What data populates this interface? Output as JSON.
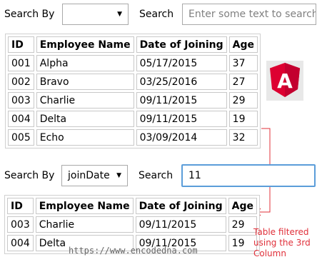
{
  "top": {
    "search_by_label": "Search By",
    "select_value": "",
    "search_label": "Search",
    "search_placeholder": "Enter some text to search",
    "table": {
      "headers": [
        "ID",
        "Employee Name",
        "Date of Joining",
        "Age"
      ],
      "rows": [
        [
          "001",
          "Alpha",
          "05/17/2015",
          "37"
        ],
        [
          "002",
          "Bravo",
          "03/25/2016",
          "27"
        ],
        [
          "003",
          "Charlie",
          "09/11/2015",
          "29"
        ],
        [
          "004",
          "Delta",
          "09/11/2015",
          "19"
        ],
        [
          "005",
          "Echo",
          "03/09/2014",
          "32"
        ]
      ]
    }
  },
  "bottom": {
    "search_by_label": "Search By",
    "select_value": "joinDate",
    "search_label": "Search",
    "search_value": "11",
    "table": {
      "headers": [
        "ID",
        "Employee Name",
        "Date of Joining",
        "Age"
      ],
      "rows": [
        [
          "003",
          "Charlie",
          "09/11/2015",
          "29"
        ],
        [
          "004",
          "Delta",
          "09/11/2015",
          "19"
        ]
      ]
    }
  },
  "logo": {
    "letter": "A",
    "icon": "angular-logo-icon",
    "colors": {
      "red": "#dd0031",
      "dark_red": "#c3002f"
    }
  },
  "annotation": {
    "lines": [
      "Table filtered",
      "using the 3rd",
      "Column"
    ],
    "color": "#e0303a"
  },
  "watermark": "https://www.encodedna.com"
}
